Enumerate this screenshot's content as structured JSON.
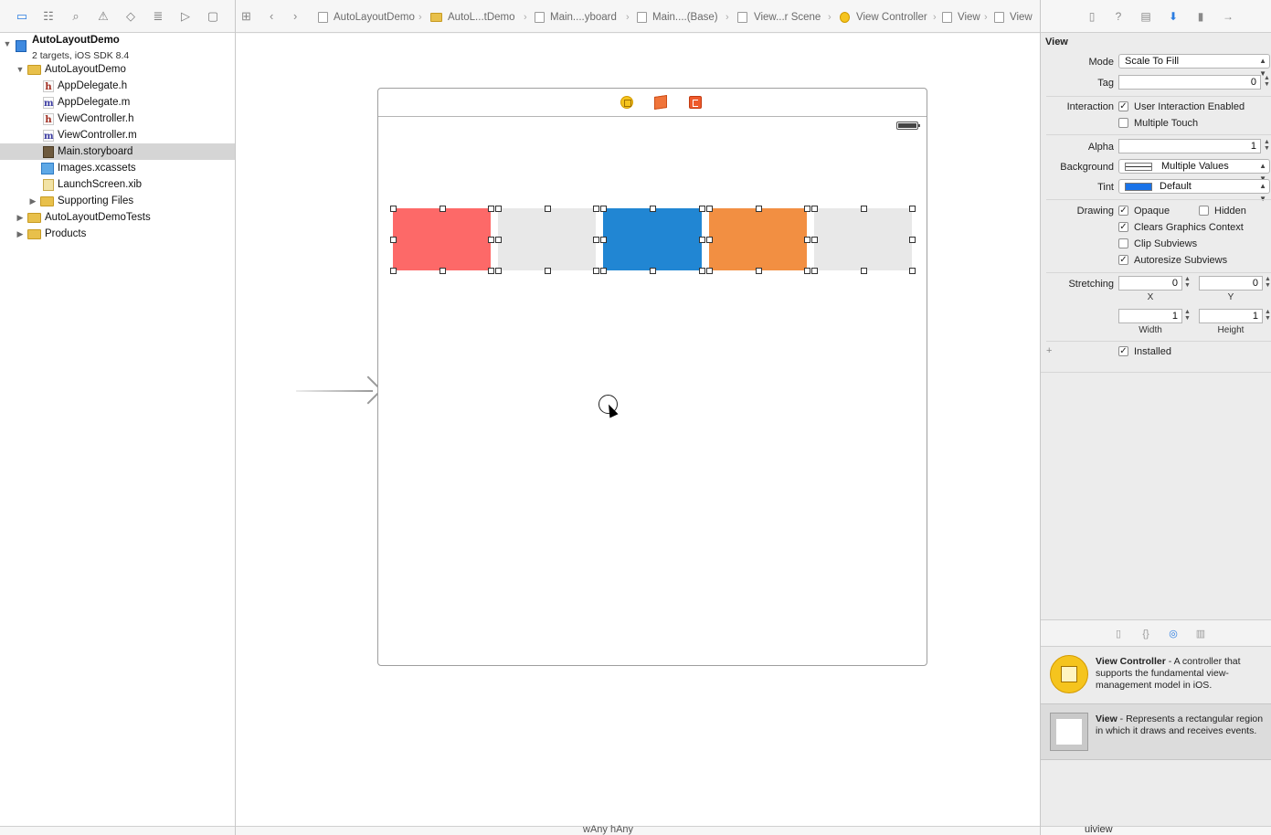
{
  "navigator": {
    "toolbar_icons": [
      "folder-icon",
      "hierarchy-icon",
      "search-icon",
      "warning-icon",
      "test-icon",
      "debug-icon",
      "breakpoint-icon",
      "report-icon"
    ],
    "project": {
      "name": "AutoLayoutDemo",
      "subtitle": "2 targets, iOS SDK 8.4"
    },
    "items": [
      {
        "label": "AutoLayoutDemo",
        "kind": "folder",
        "disclosure": "▼"
      },
      {
        "label": "AppDelegate.h",
        "kind": "h",
        "glyph": "h"
      },
      {
        "label": "AppDelegate.m",
        "kind": "m",
        "glyph": "m"
      },
      {
        "label": "ViewController.h",
        "kind": "h",
        "glyph": "h"
      },
      {
        "label": "ViewController.m",
        "kind": "m",
        "glyph": "m"
      },
      {
        "label": "Main.storyboard",
        "kind": "sb",
        "selected": true
      },
      {
        "label": "Images.xcassets",
        "kind": "xa"
      },
      {
        "label": "LaunchScreen.xib",
        "kind": "xib"
      },
      {
        "label": "Supporting Files",
        "kind": "folder",
        "disclosure": "▶"
      },
      {
        "label": "AutoLayoutDemoTests",
        "kind": "folder",
        "disclosure": "▶"
      },
      {
        "label": "Products",
        "kind": "folder",
        "disclosure": "▶"
      }
    ]
  },
  "jumpbar": {
    "crumbs": [
      "AutoLayoutDemo",
      "AutoL...tDemo",
      "Main....yboard",
      "Main....(Base)",
      "View...r Scene",
      "View Controller",
      "View",
      "View"
    ],
    "separator": "›"
  },
  "canvas": {
    "colors": {
      "red": "#fd6968",
      "gray": "#e8e8e8",
      "blue": "#2186d3",
      "orange": "#f28f42"
    },
    "size_class": "wAny hAny"
  },
  "inspector": {
    "section_title": "View",
    "mode": {
      "label": "Mode",
      "value": "Scale To Fill"
    },
    "tag": {
      "label": "Tag",
      "value": "0"
    },
    "interaction": {
      "label": "Interaction",
      "user_interaction": {
        "label": "User Interaction Enabled",
        "checked": true
      },
      "multiple_touch": {
        "label": "Multiple Touch",
        "checked": false
      }
    },
    "alpha": {
      "label": "Alpha",
      "value": "1"
    },
    "background": {
      "label": "Background",
      "value": "Multiple Values"
    },
    "tint": {
      "label": "Tint",
      "value": "Default",
      "color": "#1a73e8"
    },
    "drawing": {
      "label": "Drawing",
      "opaque": {
        "label": "Opaque",
        "checked": true
      },
      "hidden": {
        "label": "Hidden",
        "checked": false
      },
      "clears": {
        "label": "Clears Graphics Context",
        "checked": true
      },
      "clip": {
        "label": "Clip Subviews",
        "checked": false
      },
      "autoresize": {
        "label": "Autoresize Subviews",
        "checked": true
      }
    },
    "stretching": {
      "label": "Stretching",
      "x": "0",
      "y": "0",
      "width": "1",
      "height": "1",
      "x_label": "X",
      "y_label": "Y",
      "width_label": "Width",
      "height_label": "Height"
    },
    "installed": {
      "label": "Installed",
      "checked": true,
      "plus": "+"
    },
    "library": [
      {
        "title": "View Controller",
        "desc": " - A controller that supports the fundamental view-management model in iOS."
      },
      {
        "title": "View",
        "desc": " - Represents a rectangular region in which it draws and receives events."
      }
    ],
    "filter": {
      "value": "uiview"
    }
  }
}
